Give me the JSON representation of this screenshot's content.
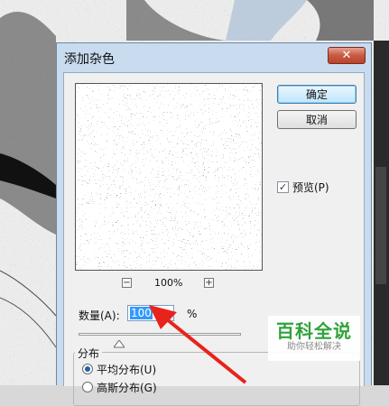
{
  "dialog": {
    "title": "添加杂色",
    "close_glyph": "✕",
    "ok_label": "确定",
    "cancel_label": "取消",
    "preview_label": "预览(P)",
    "preview_checked": true,
    "zoom_minus": "−",
    "zoom_plus": "+",
    "zoom_level": "100%",
    "amount_label": "数量(A):",
    "amount_value": "100",
    "amount_unit": "%",
    "distribution_label": "分布",
    "dist_uniform_label": "平均分布(U)",
    "dist_gaussian_label": "高斯分布(G)",
    "selected_distribution": "uniform"
  },
  "watermark": {
    "title": "百科全说",
    "subtitle": "助你轻松解决"
  },
  "colors": {
    "titlebar": "#c9dcef",
    "close_button": "#c75a41",
    "arrow": "#e8231c",
    "watermark_green": "#30a23a",
    "selection": "#3399ff"
  }
}
